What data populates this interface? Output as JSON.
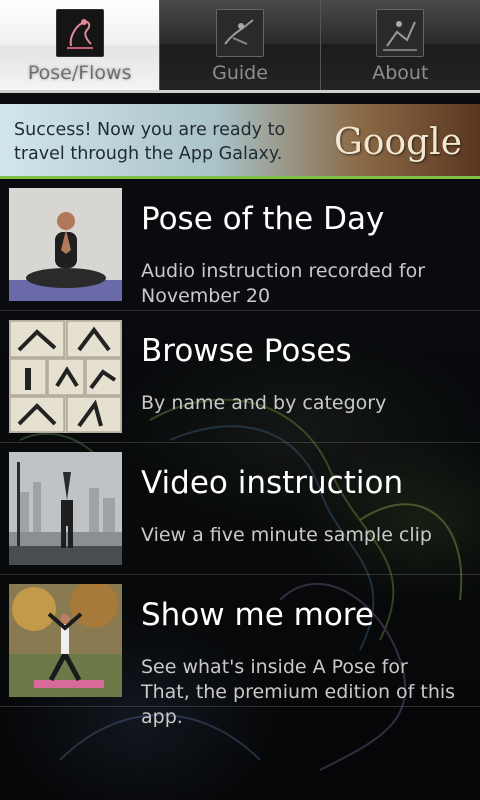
{
  "tabs": [
    {
      "label": "Pose/Flows",
      "icon": "yoga-pose-icon",
      "active": true
    },
    {
      "label": "Guide",
      "icon": "guide-pose-icon",
      "active": false
    },
    {
      "label": "About",
      "icon": "about-pose-icon",
      "active": false
    }
  ],
  "ad": {
    "text": "Success! Now you are ready to travel through the App Galaxy.",
    "brand": "Google",
    "accent_color": "#7bc043"
  },
  "items": [
    {
      "title": "Pose of the Day",
      "subtitle": "Audio instruction recorded for November 20",
      "thumb": "meditation-pose-photo"
    },
    {
      "title": "Browse Poses",
      "subtitle": "By name and by category",
      "thumb": "pose-grid-photo"
    },
    {
      "title": "Video instruction",
      "subtitle": "View a five minute sample clip",
      "thumb": "city-skyline-pose-photo"
    },
    {
      "title": "Show me more",
      "subtitle": "See what's inside A Pose for That, the premium edition of this app.",
      "thumb": "outdoor-warrior-pose-photo"
    }
  ]
}
